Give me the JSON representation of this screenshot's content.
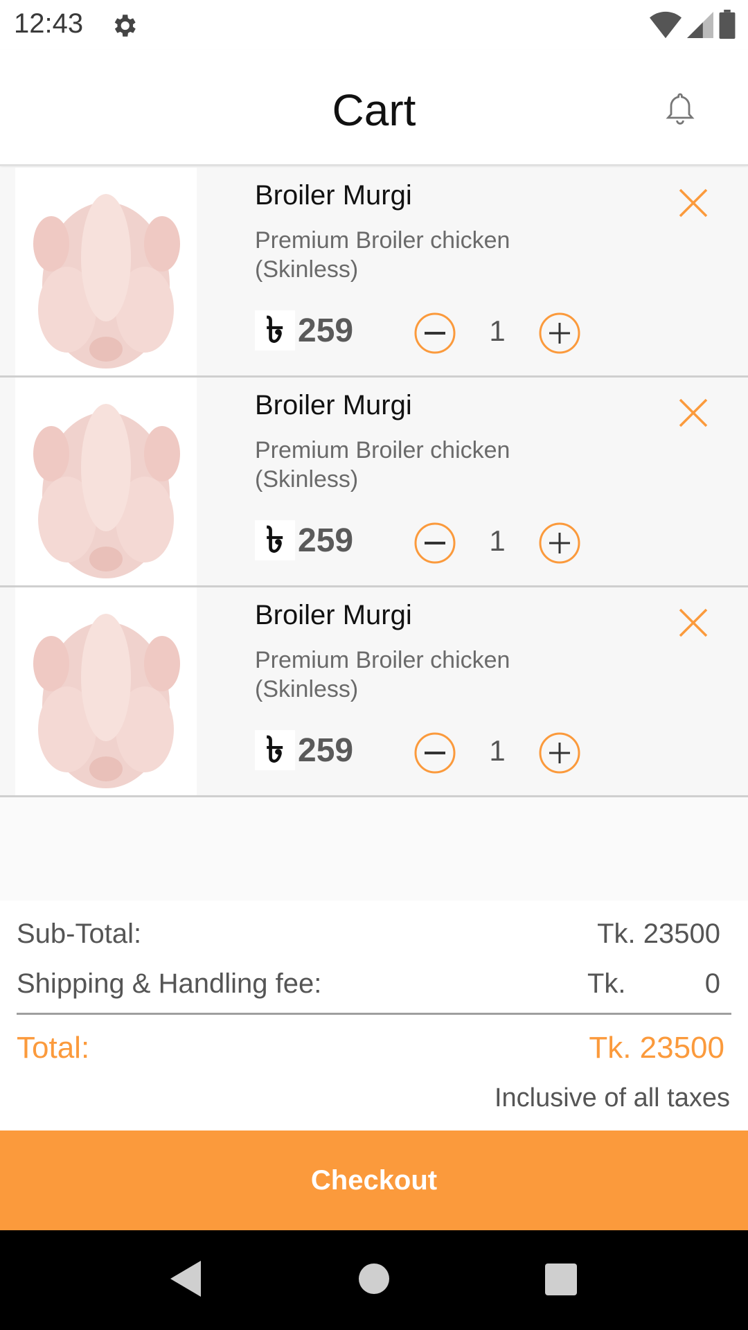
{
  "status_bar": {
    "time": "12:43"
  },
  "header": {
    "title": "Cart"
  },
  "currency_symbol": "৳",
  "cart_items": [
    {
      "name": "Broiler Murgi",
      "description": "Premium Broiler chicken (Skinless)",
      "price": "259",
      "quantity": "1"
    },
    {
      "name": "Broiler Murgi",
      "description": "Premium Broiler chicken (Skinless)",
      "price": "259",
      "quantity": "1"
    },
    {
      "name": "Broiler Murgi",
      "description": "Premium Broiler chicken (Skinless)",
      "price": "259",
      "quantity": "1"
    }
  ],
  "summary": {
    "subtotal_label": "Sub-Total:",
    "subtotal_value": "Tk. 23500",
    "shipping_label": "Shipping & Handling fee:",
    "shipping_currency": "Tk.",
    "shipping_value": "0",
    "total_label": "Total:",
    "total_value": "Tk. 23500",
    "tax_note": "Inclusive of all taxes"
  },
  "checkout_label": "Checkout",
  "colors": {
    "accent": "#fb9a3c",
    "text_secondary": "#6a6a6a",
    "divider": "#cfcfcf"
  }
}
